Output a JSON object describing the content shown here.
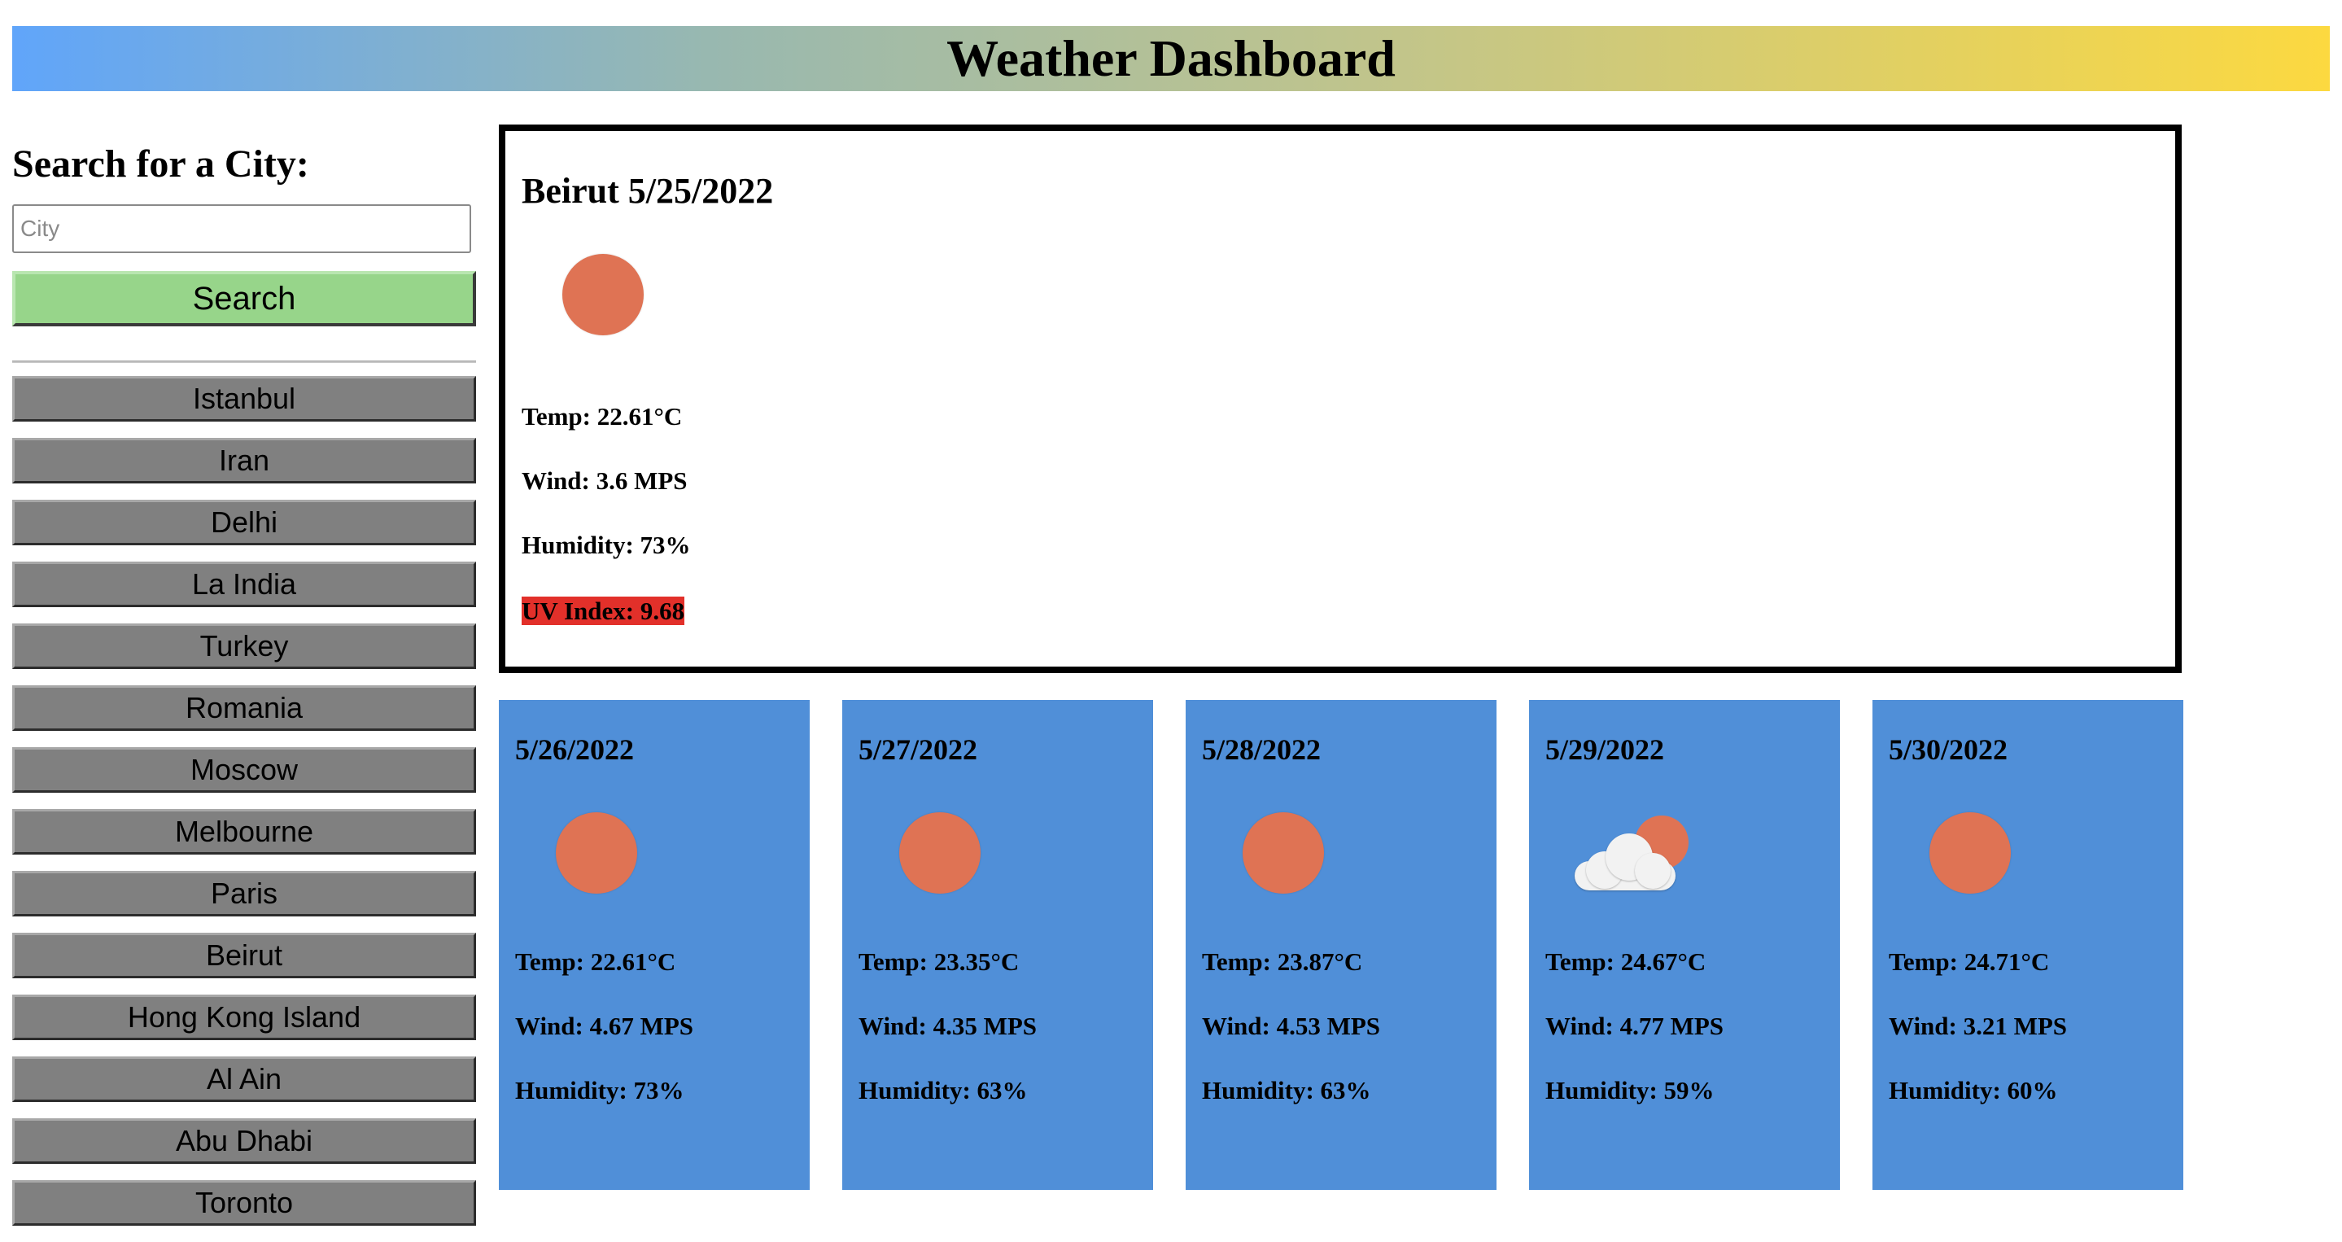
{
  "header": {
    "title": "Weather Dashboard",
    "gradient_colors": [
      "#60a5fa",
      "#fcd940"
    ]
  },
  "sidebar": {
    "heading": "Search for a City:",
    "input": {
      "placeholder": "City",
      "value": ""
    },
    "search_label": "Search",
    "history": [
      "Istanbul",
      "Iran",
      "Delhi",
      "La India",
      "Turkey",
      "Romania",
      "Moscow",
      "Melbourne",
      "Paris",
      "Beirut",
      "Hong Kong Island",
      "Al Ain",
      "Abu Dhabi",
      "Toronto"
    ]
  },
  "current": {
    "title": "Beirut 5/25/2022",
    "icon": "sun-icon",
    "temp": "Temp: 22.61°C",
    "wind": "Wind: 3.6 MPS",
    "humidity": "Humidity: 73%",
    "uv": "UV Index: 9.68",
    "uv_color": "#e2302a"
  },
  "forecast": [
    {
      "date": "5/26/2022",
      "icon": "sun-icon",
      "temp": "Temp: 22.61°C",
      "wind": "Wind: 4.67 MPS",
      "humidity": "Humidity: 73%"
    },
    {
      "date": "5/27/2022",
      "icon": "sun-icon",
      "temp": "Temp: 23.35°C",
      "wind": "Wind: 4.35 MPS",
      "humidity": "Humidity: 63%"
    },
    {
      "date": "5/28/2022",
      "icon": "sun-icon",
      "temp": "Temp: 23.87°C",
      "wind": "Wind: 4.53 MPS",
      "humidity": "Humidity: 63%"
    },
    {
      "date": "5/29/2022",
      "icon": "cloud-sun-icon",
      "temp": "Temp: 24.67°C",
      "wind": "Wind: 4.77 MPS",
      "humidity": "Humidity: 59%"
    },
    {
      "date": "5/30/2022",
      "icon": "sun-icon",
      "temp": "Temp: 24.71°C",
      "wind": "Wind: 3.21 MPS",
      "humidity": "Humidity: 60%"
    }
  ],
  "colors": {
    "forecast_card": "#508fd8",
    "search_button": "#97d58a",
    "history_button": "#808080",
    "sun": "#df7354"
  }
}
